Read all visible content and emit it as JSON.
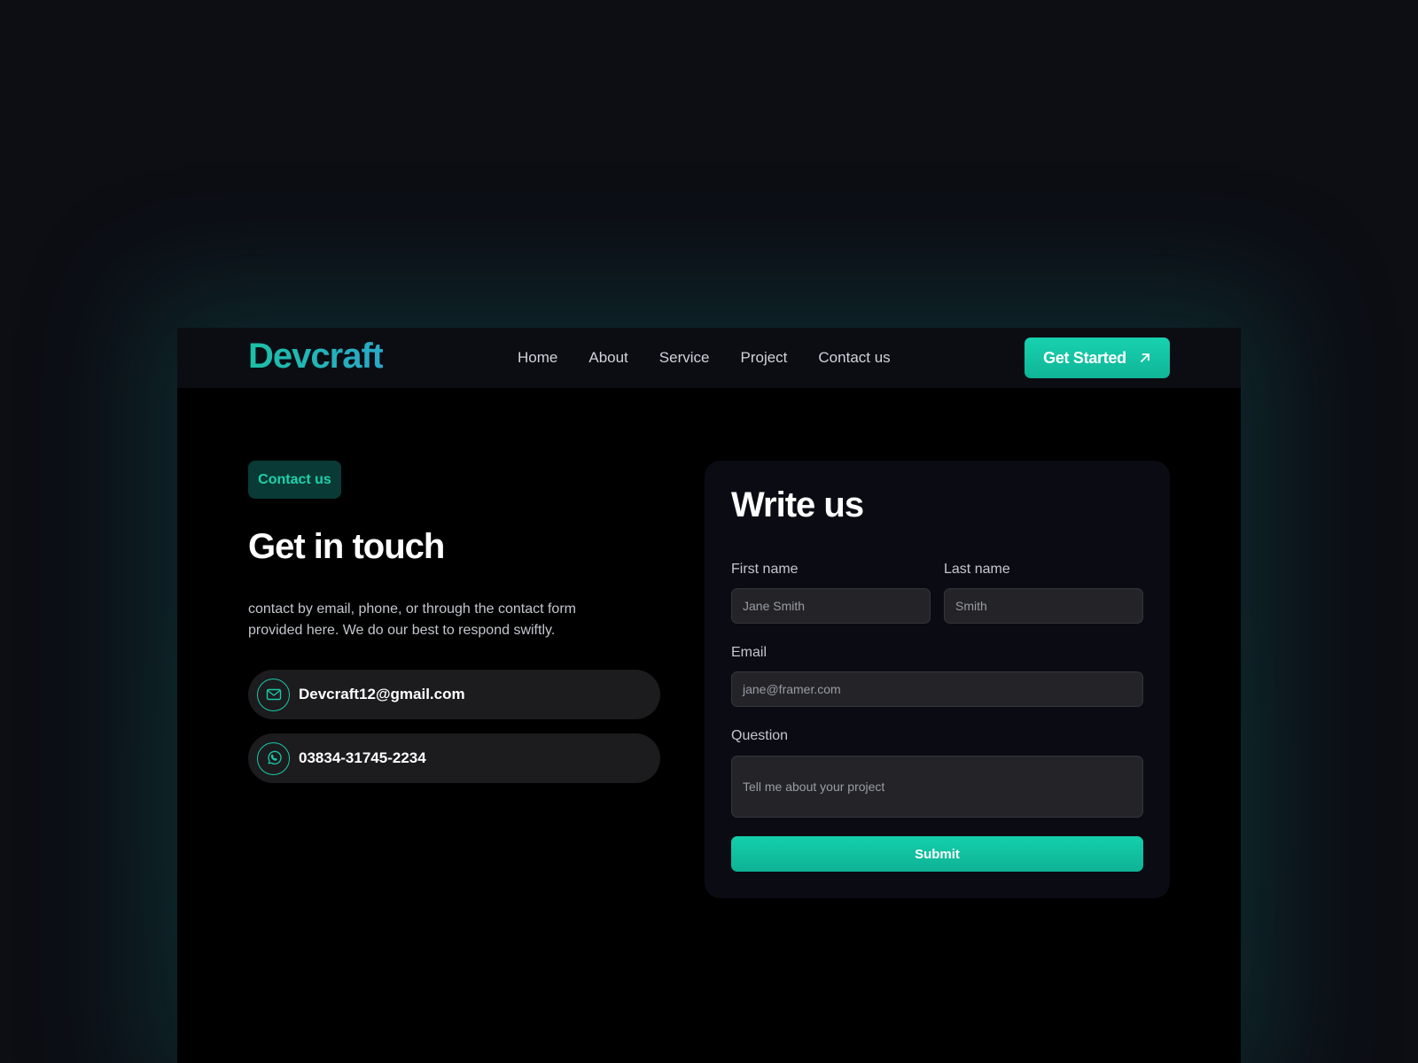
{
  "brand": {
    "logo": "Devcraft",
    "accent": "#17c7a8"
  },
  "nav": {
    "links": [
      "Home",
      "About",
      "Service",
      "Project",
      "Contact us"
    ],
    "cta_label": "Get Started",
    "cta_icon": "arrow-up-right-icon"
  },
  "contact": {
    "badge": "Contact us",
    "title": "Get in touch",
    "description": "contact by email, phone, or through the contact form provided here. We do our best to respond swiftly.",
    "email": "Devcraft12@gmail.com",
    "email_icon": "mail-icon",
    "phone": "03834-31745-2234",
    "phone_icon": "whatsapp-icon"
  },
  "form": {
    "title": "Write us",
    "first_name_label": "First name",
    "first_name_placeholder": "Jane Smith",
    "last_name_label": "Last name",
    "last_name_placeholder": "Smith",
    "email_label": "Email",
    "email_placeholder": "jane@framer.com",
    "question_label": "Question",
    "question_placeholder": "Tell me about your project",
    "submit_label": "Submit"
  }
}
